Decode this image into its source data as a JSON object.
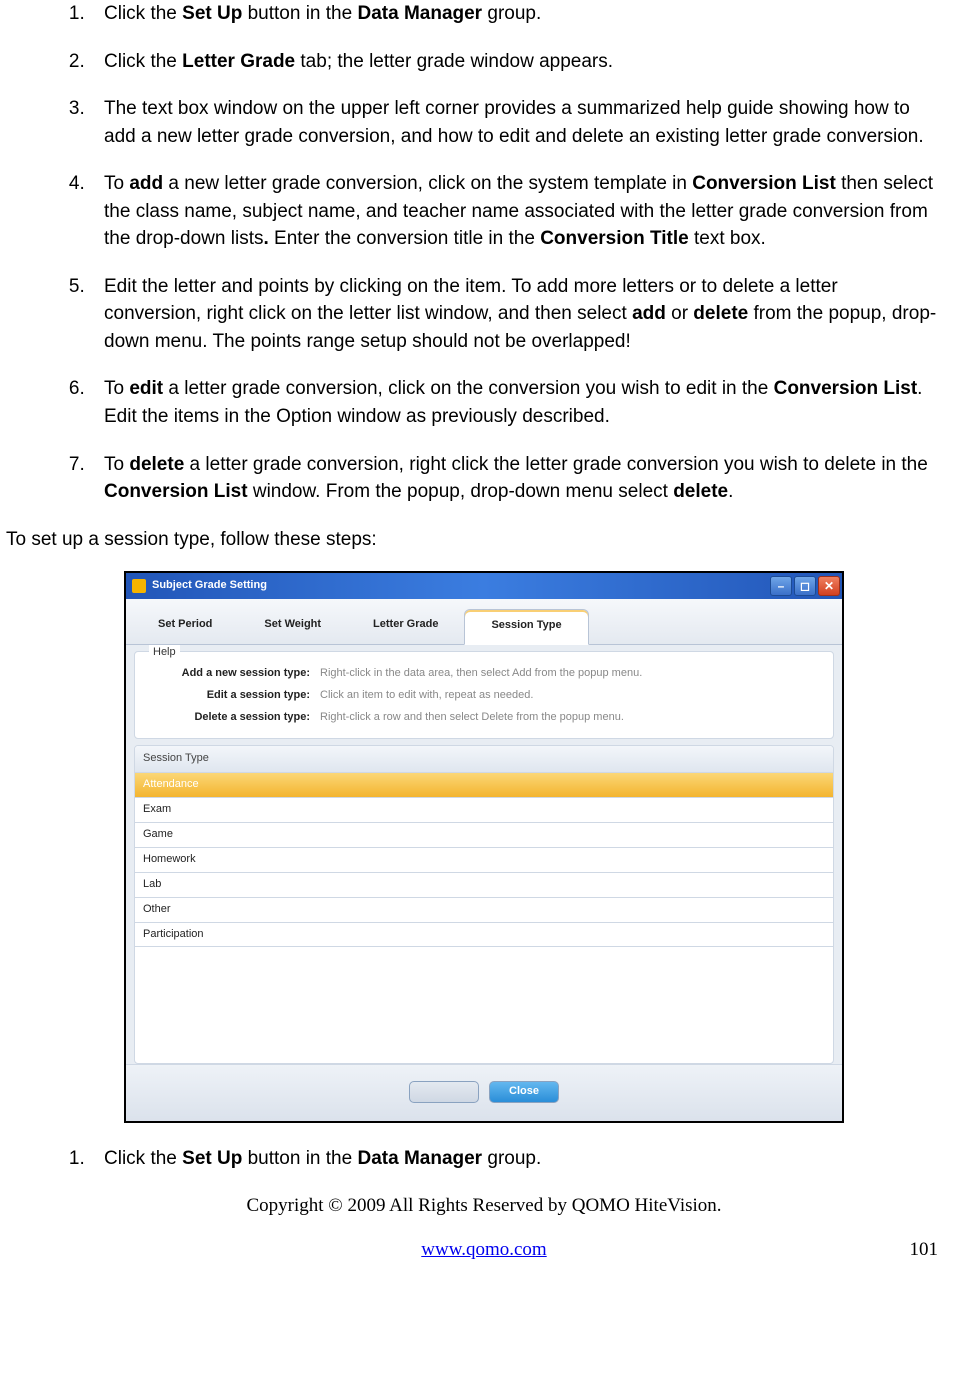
{
  "steps_a": [
    {
      "pre": "Click the ",
      "b1": "Set Up",
      "mid": " button in the ",
      "b2": "Data Manager",
      "post": " group."
    },
    {
      "pre": "Click the ",
      "b1": "Letter Grade",
      "mid": " tab; the letter grade window appears.",
      "b2": "",
      "post": ""
    },
    {
      "text": "The text box window on the upper left corner provides a summarized help guide showing how to add a new letter grade conversion, and how to edit and delete an existing letter grade conversion."
    },
    {
      "pre": "To ",
      "b1": "add",
      "mid": " a new letter grade conversion, click on the system template in ",
      "b2": "Conversion List",
      "post_pre": " then select the class name, subject name, and teacher name associated with the letter grade conversion from the drop-down lists",
      "b3": ".",
      "post_mid": " Enter the conversion title in the ",
      "b4": "Conversion Title",
      "post_end": " text box."
    },
    {
      "pre": "Edit the letter and points by clicking on the item. To add more letters or to delete a letter conversion, right click on the letter list window, and then select ",
      "b1": "add",
      "mid": " or ",
      "b2": "delete",
      "post": " from the popup, drop-down menu. The points range setup should not be overlapped!"
    },
    {
      "pre": "To ",
      "b1": "edit",
      "mid": " a letter grade conversion, click on the conversion you wish to edit in the ",
      "b2": "Conversion List",
      "post": ". Edit the items in the Option window as previously described."
    },
    {
      "pre": "To ",
      "b1": "delete",
      "mid": " a letter grade conversion, right click the letter grade conversion you wish to delete in the ",
      "b2": "Conversion List",
      "post_pre": " window. From the popup, drop-down menu select ",
      "b3": "delete",
      "post_end": "."
    }
  ],
  "intro_b": "To set up a session type, follow these steps:",
  "window": {
    "title": "Subject Grade Setting",
    "tabs": [
      "Set Period",
      "Set Weight",
      "Letter Grade",
      "Session Type"
    ],
    "active_tab": 3,
    "help_label": "Help",
    "help_rows": [
      {
        "k": "Add a new session type:",
        "v": "Right-click in the data area, then select Add from the popup menu."
      },
      {
        "k": "Edit a session type:",
        "v": "Click an item to edit with, repeat as needed."
      },
      {
        "k": "Delete a session type:",
        "v": "Right-click a row and then select Delete from the popup menu."
      }
    ],
    "list_header": "Session Type",
    "list_items": [
      "Attendance",
      "Exam",
      "Game",
      "Homework",
      "Lab",
      "Other",
      "Participation"
    ],
    "selected_index": 0,
    "close_label": "Close"
  },
  "steps_b": [
    {
      "pre": "Click the ",
      "b1": "Set Up",
      "mid": " button in the ",
      "b2": "Data Manager",
      "post": " group."
    }
  ],
  "footer": {
    "copyright": "Copyright © 2009 All Rights Reserved by QOMO HiteVision.",
    "link": "www.qomo.com",
    "page": "101"
  }
}
